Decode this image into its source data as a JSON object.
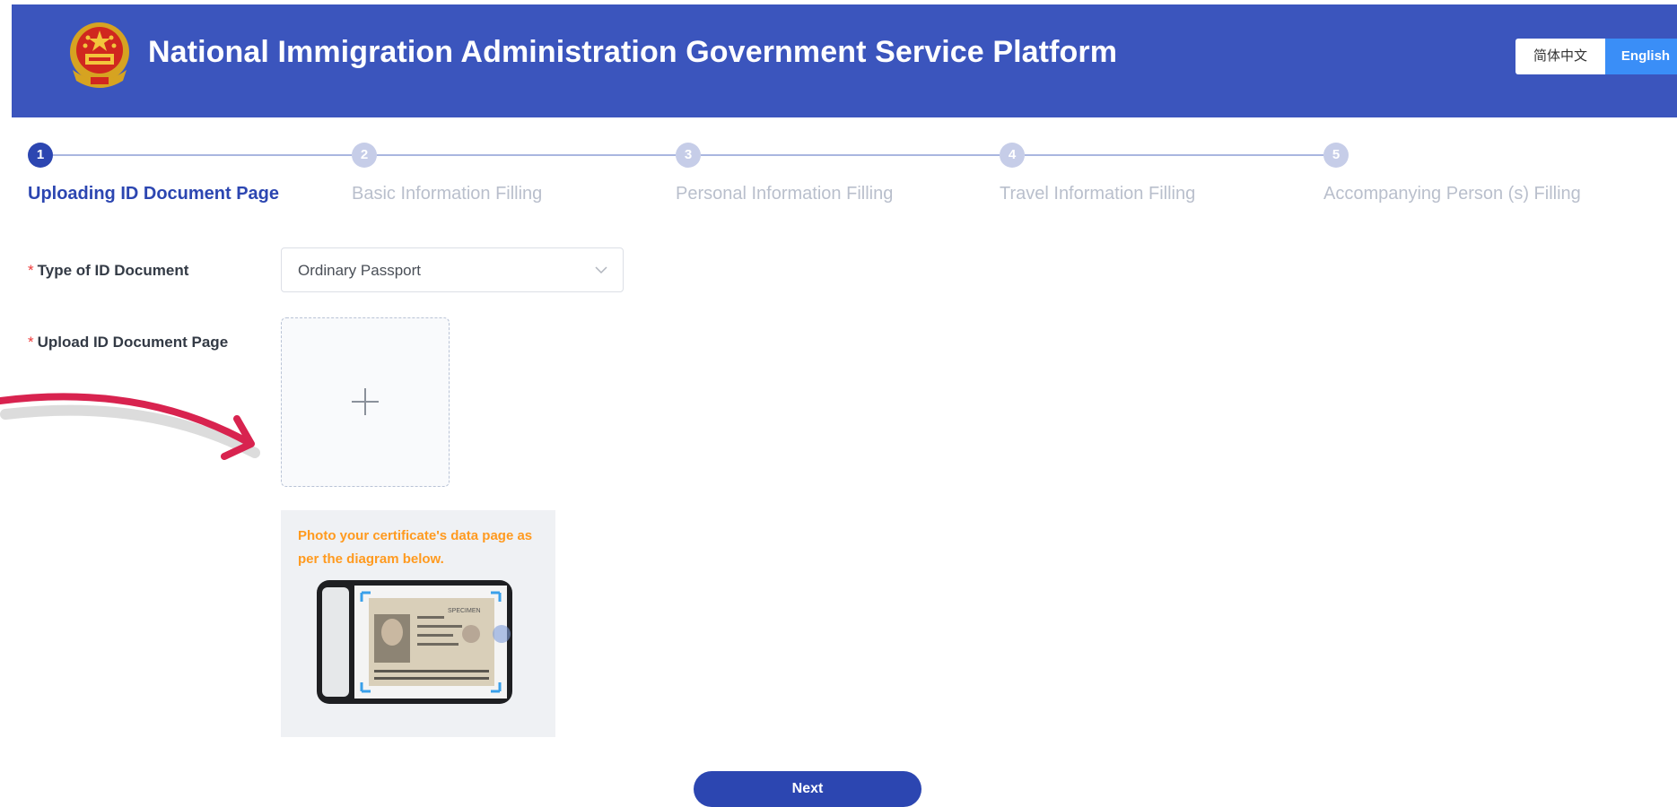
{
  "header": {
    "title": "National Immigration Administration Government Service Platform",
    "emblem": "national-emblem-icon",
    "languages": [
      {
        "label": "简体中文",
        "active": false
      },
      {
        "label": "English",
        "active": true
      }
    ]
  },
  "steps": [
    {
      "number": "1",
      "label": "Uploading ID Document Page",
      "active": true
    },
    {
      "number": "2",
      "label": "Basic Information Filling",
      "active": false
    },
    {
      "number": "3",
      "label": "Personal Information Filling",
      "active": false
    },
    {
      "number": "4",
      "label": "Travel Information Filling",
      "active": false
    },
    {
      "number": "5",
      "label": "Accompanying Person (s) Filling",
      "active": false
    }
  ],
  "form": {
    "required_mark": "*",
    "document_type": {
      "label": "Type of ID Document",
      "value": "Ordinary Passport",
      "icon": "chevron-down-icon"
    },
    "upload": {
      "label": "Upload ID Document Page",
      "icon": "plus-icon"
    },
    "guide": {
      "text": "Photo your certificate's data page as per the diagram below.",
      "illustration_text": "SPECIMEN"
    }
  },
  "actions": {
    "next_label": "Next"
  },
  "colors": {
    "header_bg": "#3b55bd",
    "primary": "#2c46b1",
    "lang_active": "#3a8ef7",
    "guide_text": "#ff9a1f",
    "required": "#ee3b3b",
    "arrow": "#d8234f"
  }
}
